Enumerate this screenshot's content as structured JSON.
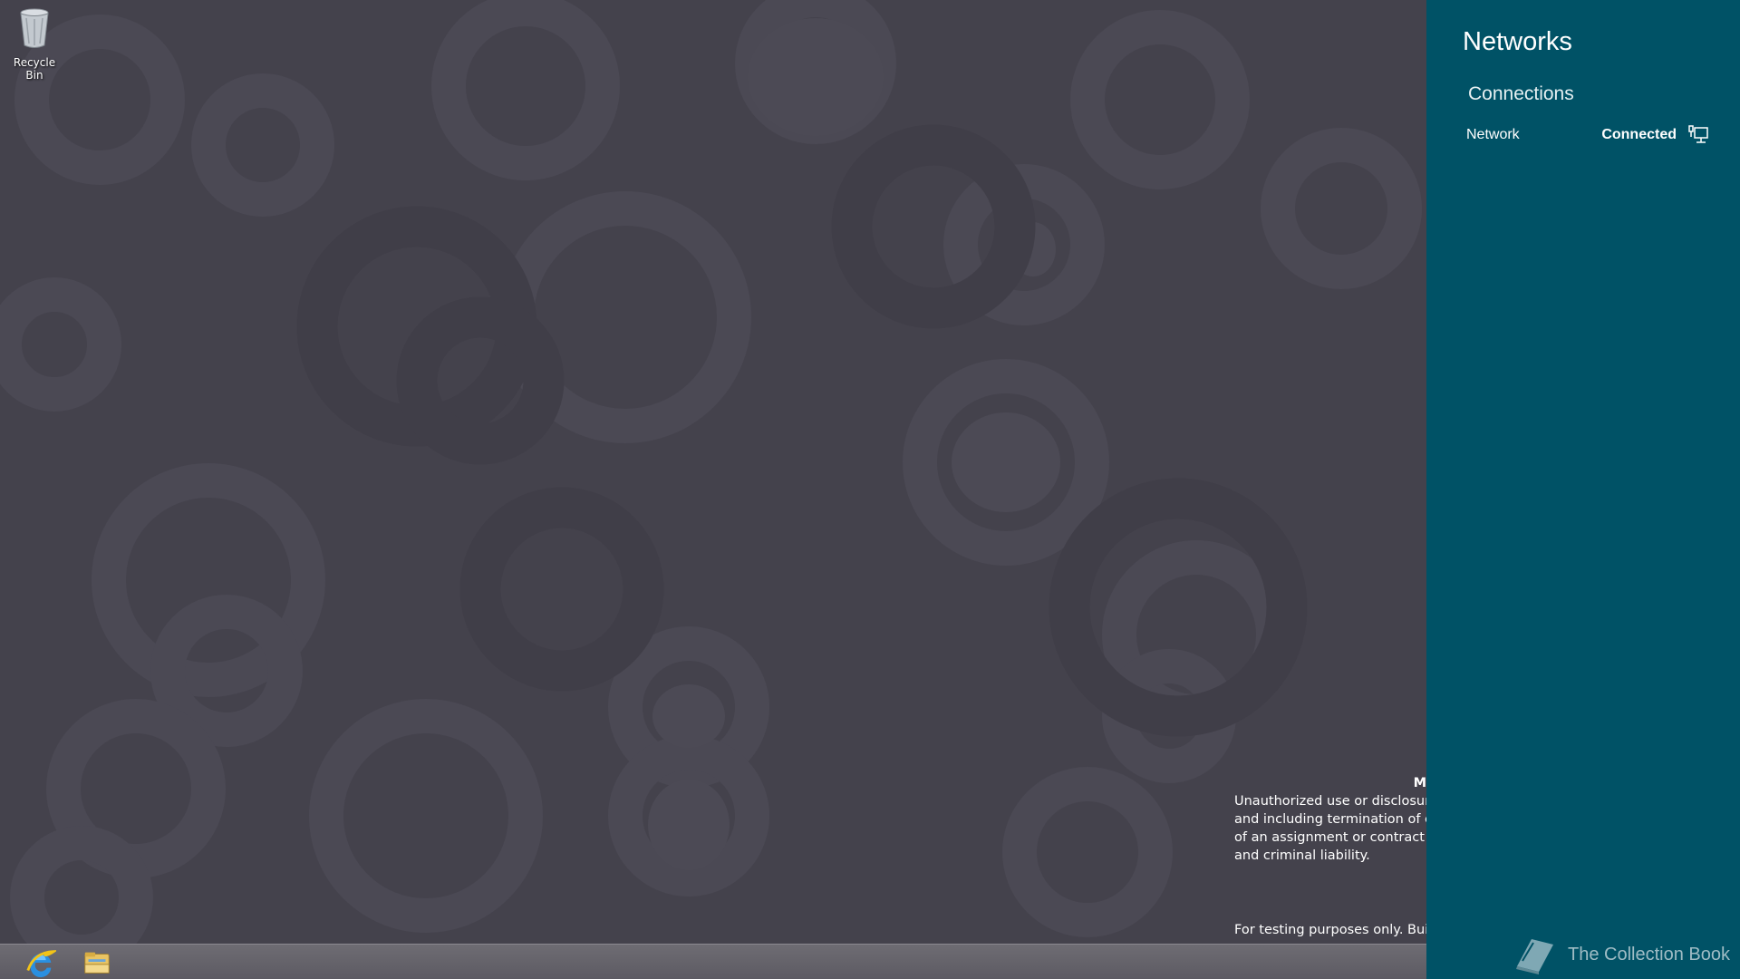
{
  "desktop": {
    "icons": [
      {
        "label": "Recycle Bin",
        "icon": "recycle-bin-icon"
      }
    ],
    "watermark": {
      "title": "M",
      "lines": [
        "Unauthorized use or disclosure i",
        "and including termination of em",
        "of an assignment or contract (in",
        "and criminal liability."
      ],
      "build": "For testing purposes only. Build"
    }
  },
  "taskbar": {
    "items": [
      {
        "icon": "internet-explorer-icon"
      },
      {
        "icon": "file-explorer-icon"
      }
    ]
  },
  "charm_panel": {
    "title": "Networks",
    "section": "Connections",
    "connections": [
      {
        "name": "Network",
        "status": "Connected",
        "icon": "wired-network-icon"
      }
    ],
    "brand": "The Collection Book",
    "background": "#005266"
  },
  "colors": {
    "wallpaper": "#44424c",
    "wallpaper_shape": "#4c4a55",
    "panel": "#005266"
  }
}
